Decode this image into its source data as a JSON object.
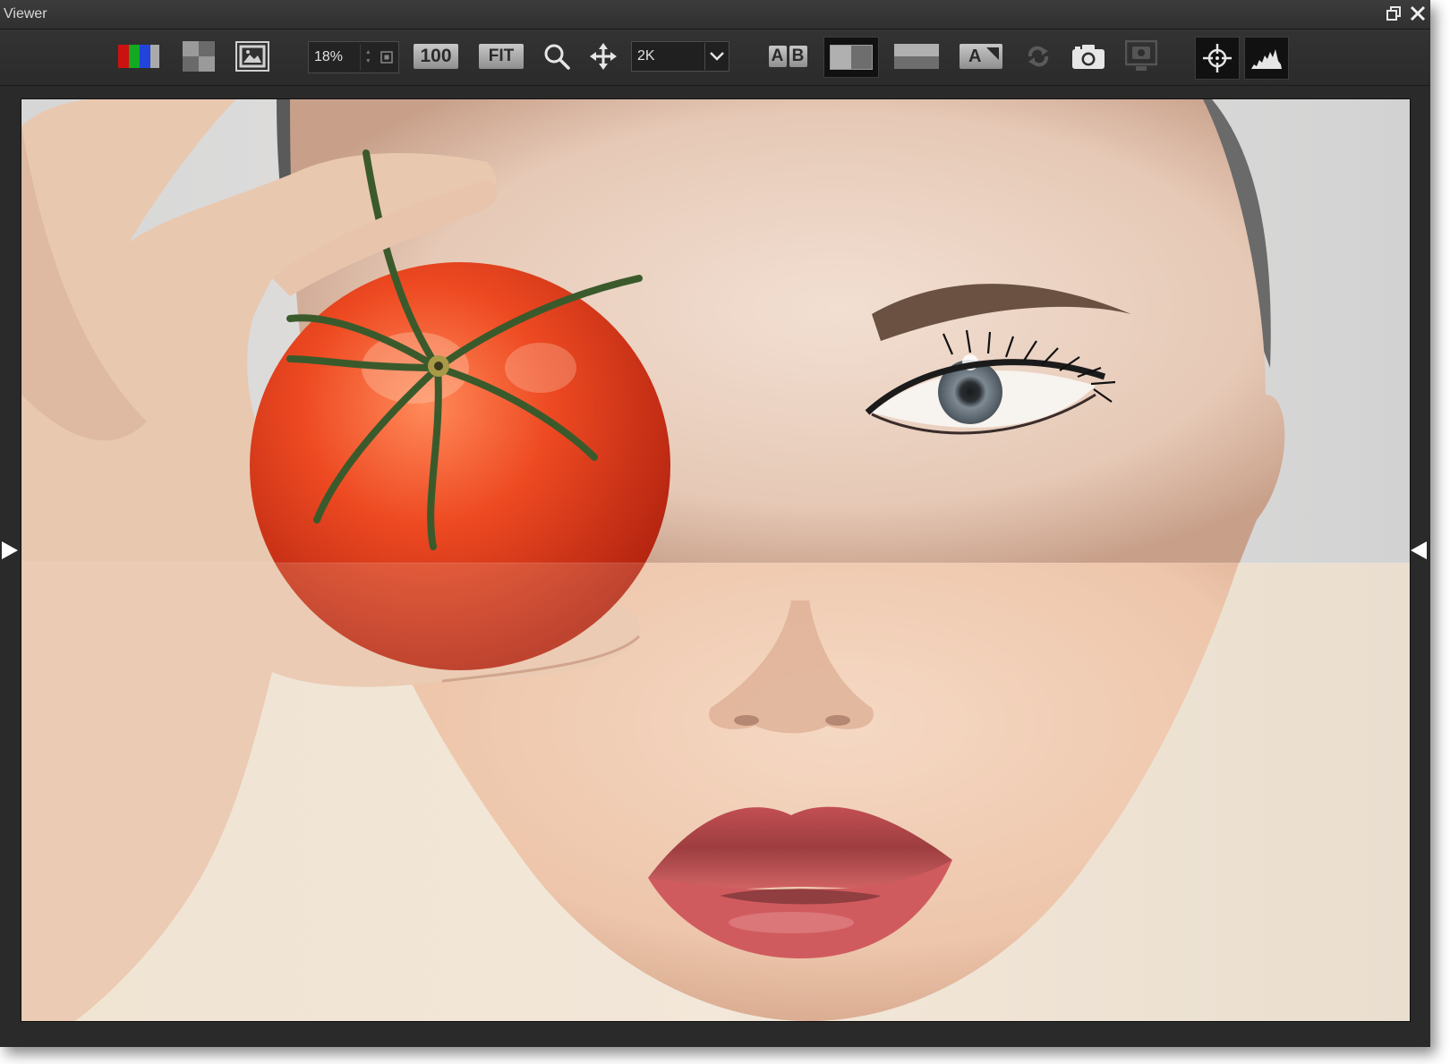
{
  "window": {
    "title": "Viewer",
    "restore_icon": "restore-window-icon",
    "close_icon": "close-icon"
  },
  "toolbar": {
    "channels_icon": "rgb-channels-icon",
    "checker_icon": "checkerboard-icon",
    "frame_icon": "image-frame-icon",
    "zoom_value": "18%",
    "zoom_100_label": "100",
    "fit_label": "FIT",
    "search_icon": "magnifier-icon",
    "pan_icon": "pan-move-icon",
    "resolution": {
      "selected": "2K"
    },
    "ab_label_a": "A",
    "ab_label_b": "B",
    "split_vertical_icon": "split-vertical-icon",
    "split_horizontal_icon": "split-horizontal-icon",
    "overlay_label": "A",
    "sync_icon": "sync-icon",
    "snapshot_icon": "camera-icon",
    "snapshot_view_icon": "snapshot-display-icon",
    "crosshair_icon": "crosshair-icon",
    "histogram_icon": "histogram-icon"
  },
  "viewer": {
    "image_description": "photo comparison",
    "wipe_position": 0.505
  },
  "colors": {
    "background": "#2a2a2a",
    "toolbar": "#303030",
    "button_gray": "#a8a8a8"
  }
}
